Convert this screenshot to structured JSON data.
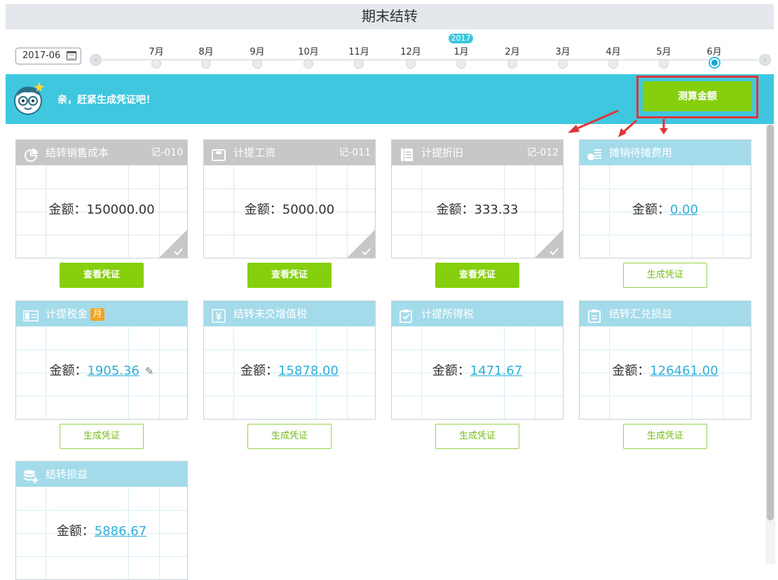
{
  "page": {
    "title": "期末结转"
  },
  "timeline": {
    "date_value": "2017-06",
    "year_badge": "2017",
    "months": [
      "7月",
      "8月",
      "9月",
      "10月",
      "11月",
      "12月",
      "1月",
      "2月",
      "3月",
      "4月",
      "5月",
      "6月"
    ],
    "active_month": "6月"
  },
  "banner": {
    "message": "亲，赶紧生成凭证吧！",
    "calc_button": "测算金额"
  },
  "cards": [
    {
      "title": "结转销售成本",
      "voucher_no": "记-010",
      "amount_label": "金额：",
      "amount": "150000.00",
      "status": "done",
      "icon": "pie-chart-icon",
      "button": "查看凭证"
    },
    {
      "title": "计提工资",
      "voucher_no": "记-011",
      "amount_label": "金额：",
      "amount": "5000.00",
      "status": "done",
      "icon": "wallet-icon",
      "button": "查看凭证"
    },
    {
      "title": "计提折旧",
      "voucher_no": "记-012",
      "amount_label": "金额：",
      "amount": "333.33",
      "status": "done",
      "icon": "documents-icon",
      "button": "查看凭证"
    },
    {
      "title": "摊销待摊费用",
      "voucher_no": "",
      "amount_label": "金额：",
      "amount": "0.00",
      "status": "todo",
      "icon": "coins-list-icon",
      "button": "生成凭证"
    },
    {
      "title": "计提税金",
      "badge": "月",
      "voucher_no": "",
      "amount_label": "金额：",
      "amount": "1905.36",
      "status": "todo",
      "icon": "tax-icon",
      "button": "生成凭证",
      "editable": true
    },
    {
      "title": "结转未交增值税",
      "voucher_no": "",
      "amount_label": "金额：",
      "amount": "15878.00",
      "status": "todo",
      "icon": "yuan-card-icon",
      "button": "生成凭证"
    },
    {
      "title": "计提所得税",
      "voucher_no": "",
      "amount_label": "金额：",
      "amount": "1471.67",
      "status": "todo",
      "icon": "clipboard-check-icon",
      "button": "生成凭证"
    },
    {
      "title": "结转汇兑损益",
      "voucher_no": "",
      "amount_label": "金额：",
      "amount": "126461.00",
      "status": "todo",
      "icon": "clipboard-icon",
      "button": "生成凭证"
    },
    {
      "title": "结转损益",
      "voucher_no": "",
      "amount_label": "金额：",
      "amount": "5886.67",
      "status": "todo",
      "icon": "database-plus-icon",
      "button": ""
    }
  ],
  "colors": {
    "accent_cyan": "#3ec7df",
    "green_button": "#86cf0c",
    "highlight_red": "#e0343a",
    "link_blue": "#30afd8"
  }
}
